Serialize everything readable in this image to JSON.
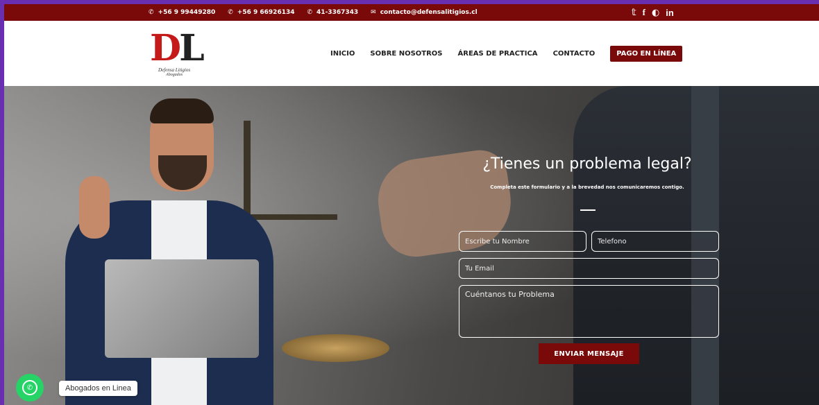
{
  "topbar": {
    "phones": [
      {
        "icon": "phone-icon",
        "label": "+56 9 99449280"
      },
      {
        "icon": "phone-icon",
        "label": "+56 9 66926134"
      },
      {
        "icon": "phone-icon",
        "label": "41-3367343"
      },
      {
        "icon": "mail-icon",
        "label": "contacto@defensalitigios.cl"
      }
    ],
    "social": [
      "twitter-icon",
      "facebook-icon",
      "instagram-icon",
      "linkedin-icon"
    ]
  },
  "logo": {
    "letters_d": "D",
    "letters_l": "L",
    "line1": "Defensa Litigios",
    "line2": "Abogados"
  },
  "nav": {
    "items": [
      "INICIO",
      "SOBRE NOSOTROS",
      "ÁREAS DE PRACTICA",
      "CONTACTO"
    ],
    "pay": "PAGO EN LÍNEA"
  },
  "form": {
    "title": "¿Tienes un problema legal?",
    "subtitle": "Completa este formulario y a la brevedad nos comunicaremos contigo.",
    "name_placeholder": "Escribe tu Nombre",
    "phone_placeholder": "Telefono",
    "email_placeholder": "Tu Email",
    "message_placeholder": "Cuéntanos tu Problema",
    "submit": "ENVIAR MENSAJE"
  },
  "whatsapp": {
    "label": "Abogados en Linea"
  },
  "colors": {
    "brand": "#7a0a0a",
    "accent_red": "#c41a1a",
    "frame": "#6a2fb0",
    "whatsapp": "#25d366"
  }
}
